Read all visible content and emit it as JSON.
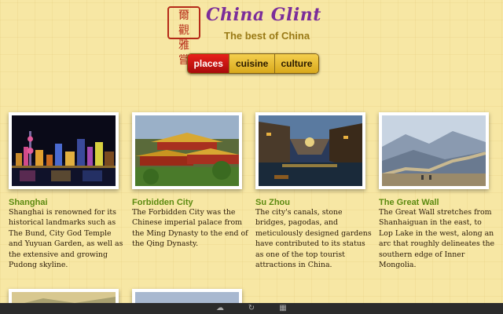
{
  "header": {
    "seal_glyphs": [
      "爾",
      "觀",
      "雅",
      "嘗"
    ],
    "brand": "China Glint",
    "tagline": "The best of China"
  },
  "tabs": [
    {
      "label": "places",
      "active": true
    },
    {
      "label": "cuisine",
      "active": false
    },
    {
      "label": "culture",
      "active": false
    }
  ],
  "cards": [
    {
      "title": "Shanghai",
      "description": "Shanghai is renowned for its historical landmarks such as The Bund, City God Temple and Yuyuan Garden, as well as the extensive and growing Pudong skyline."
    },
    {
      "title": "Forbidden City",
      "description": "The Forbidden City was the Chinese imperial palace from the Ming Dynasty to the end of the Qing Dynasty."
    },
    {
      "title": "Su Zhou",
      "description": "The city's canals, stone bridges, pagodas, and meticulously designed gardens have contributed to its status as one of the top tourist attractions in China."
    },
    {
      "title": "The Great Wall",
      "description": "The Great Wall stretches from Shanhaiguan in the east, to Lop Lake in the west, along an arc that roughly delineates the southern edge of Inner Mongolia."
    }
  ],
  "bottom_icons": [
    "cloud-icon",
    "refresh-icon",
    "grid-icon"
  ],
  "colors": {
    "background": "#f7e7a4",
    "brand": "#7b2d9a",
    "tagline": "#9a7a16",
    "active_tab": "#c8150f",
    "tab": "#e8bb30",
    "card_title": "#5c8a10"
  }
}
